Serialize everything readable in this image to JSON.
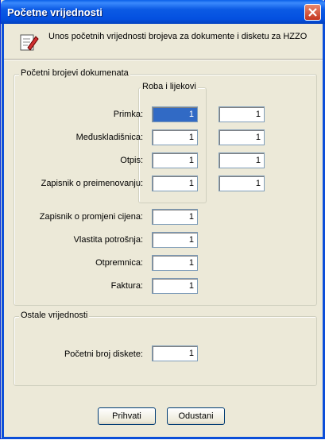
{
  "window": {
    "title": "Početne vrijednosti"
  },
  "header": {
    "info_text": "Unos početnih vrijednosti brojeva za dokumente i disketu za HZZO"
  },
  "docs_group": {
    "legend": "Početni brojevi dokumenata",
    "subgroup_legend": "Roba i lijekovi",
    "rows": [
      {
        "label": "Primka:",
        "roba": "1",
        "other": "1"
      },
      {
        "label": "Međuskladišnica:",
        "roba": "1",
        "other": "1"
      },
      {
        "label": "Otpis:",
        "roba": "1",
        "other": "1"
      },
      {
        "label": "Zapisnik o preimenovanju:",
        "roba": "1",
        "other": "1"
      }
    ],
    "single_rows": [
      {
        "label": "Zapisnik o promjeni cijena:",
        "value": "1"
      },
      {
        "label": "Vlastita potrošnja:",
        "value": "1"
      },
      {
        "label": "Otpremnica:",
        "value": "1"
      },
      {
        "label": "Faktura:",
        "value": "1"
      }
    ]
  },
  "other_group": {
    "legend": "Ostale vrijednosti",
    "label": "Početni broj diskete:",
    "value": "1"
  },
  "buttons": {
    "accept": "Prihvati",
    "cancel": "Odustani"
  },
  "colors": {
    "titlebar": "#0a5fe8",
    "window_bg": "#ece9d8",
    "selection": "#316ac5"
  }
}
